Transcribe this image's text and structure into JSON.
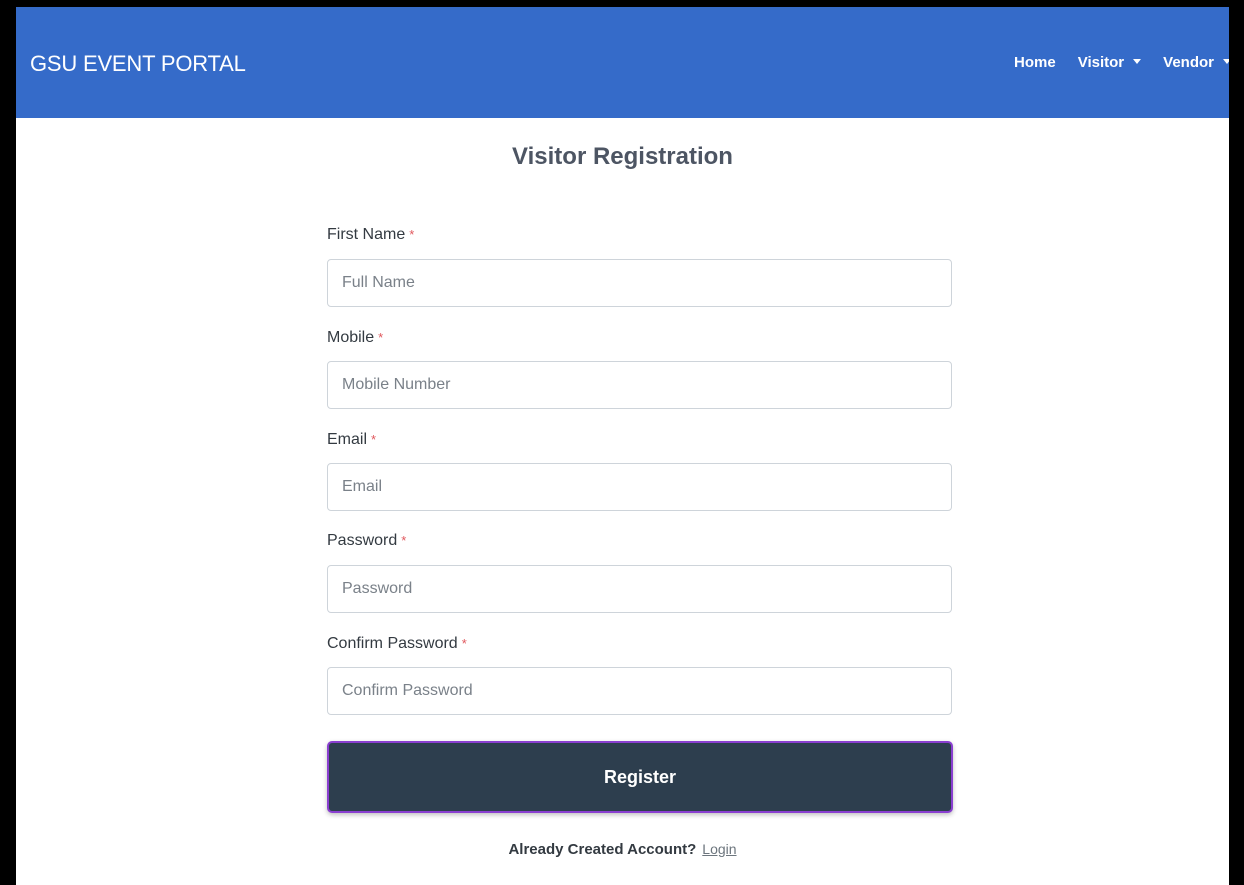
{
  "navbar": {
    "brand": "GSU EVENT PORTAL",
    "links": {
      "home": "Home",
      "visitor": "Visitor",
      "vendor": "Vendor"
    }
  },
  "form": {
    "title": "Visitor Registration",
    "required_marker": "*",
    "fields": [
      {
        "label": "First Name",
        "placeholder": "Full Name",
        "value": ""
      },
      {
        "label": "Mobile",
        "placeholder": "Mobile Number",
        "value": ""
      },
      {
        "label": "Email",
        "placeholder": "Email",
        "value": ""
      },
      {
        "label": "Password",
        "placeholder": "Password",
        "value": ""
      },
      {
        "label": "Confirm Password",
        "placeholder": "Confirm Password",
        "value": ""
      }
    ],
    "submit_label": "Register"
  },
  "footer": {
    "text": "Already Created Account?",
    "login_link": "Login"
  },
  "colors": {
    "navbar_bg": "#356bc9",
    "button_bg": "#2d3e4e",
    "button_border": "#8a3fd0",
    "required_marker": "#e0575c"
  },
  "icons": {
    "dropdown": "caret-down-icon"
  }
}
